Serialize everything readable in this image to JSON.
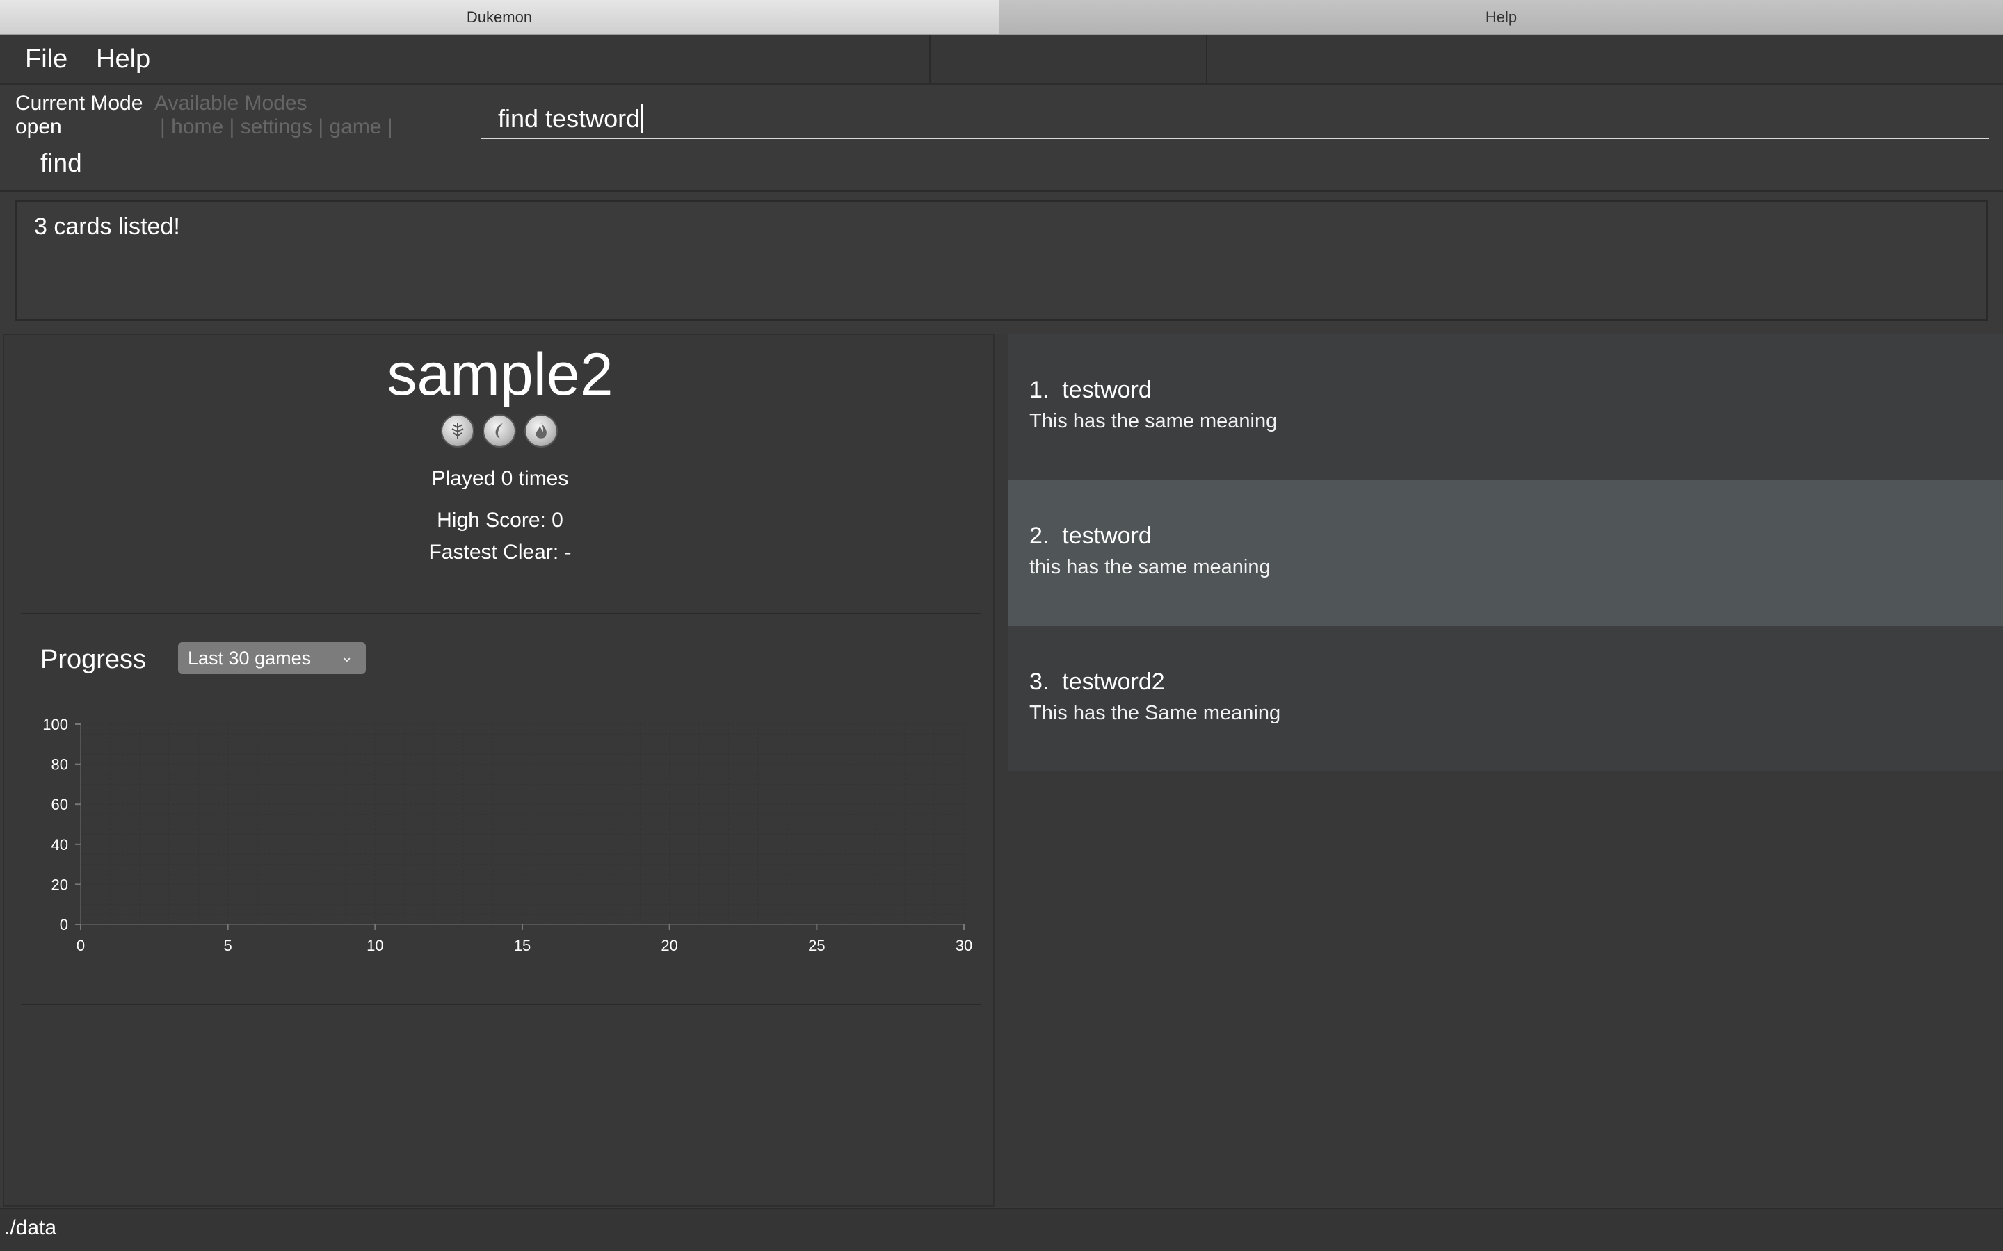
{
  "window": {
    "tabs": [
      {
        "label": "Dukemon",
        "active": true
      },
      {
        "label": "Help",
        "active": false
      }
    ]
  },
  "menu": {
    "file": "File",
    "help": "Help"
  },
  "mode": {
    "current_label": "Current Mode",
    "current_value": "open",
    "available_label": "Available Modes",
    "available_list": "| home | settings | game |",
    "command_name": "find"
  },
  "command_input": {
    "value": "find testword"
  },
  "result": {
    "message": "3 cards listed!"
  },
  "wordbank": {
    "name": "sample2",
    "badges": [
      "leaf-badge-icon",
      "water-badge-icon",
      "fire-badge-icon"
    ],
    "played": "Played 0 times",
    "high_score": "High Score: 0",
    "fastest_clear": "Fastest Clear:  -"
  },
  "progress": {
    "title": "Progress",
    "dropdown_value": "Last 30 games"
  },
  "chart_data": {
    "type": "line",
    "series": [],
    "xlim": [
      0,
      30
    ],
    "ylim": [
      0,
      100
    ],
    "x_ticks": [
      "0",
      "5",
      "10",
      "15",
      "20",
      "25",
      "30"
    ],
    "y_ticks": [
      "0",
      "20",
      "40",
      "60",
      "80",
      "100"
    ],
    "grid": true
  },
  "cards": [
    {
      "index": "1.",
      "word": "testword",
      "meaning": "This has the same meaning",
      "selected": false
    },
    {
      "index": "2.",
      "word": "testword",
      "meaning": "this has the same meaning",
      "selected": true
    },
    {
      "index": "3.",
      "word": "testword2",
      "meaning": "This has the Same meaning",
      "selected": false
    }
  ],
  "status": {
    "path": "./data"
  }
}
